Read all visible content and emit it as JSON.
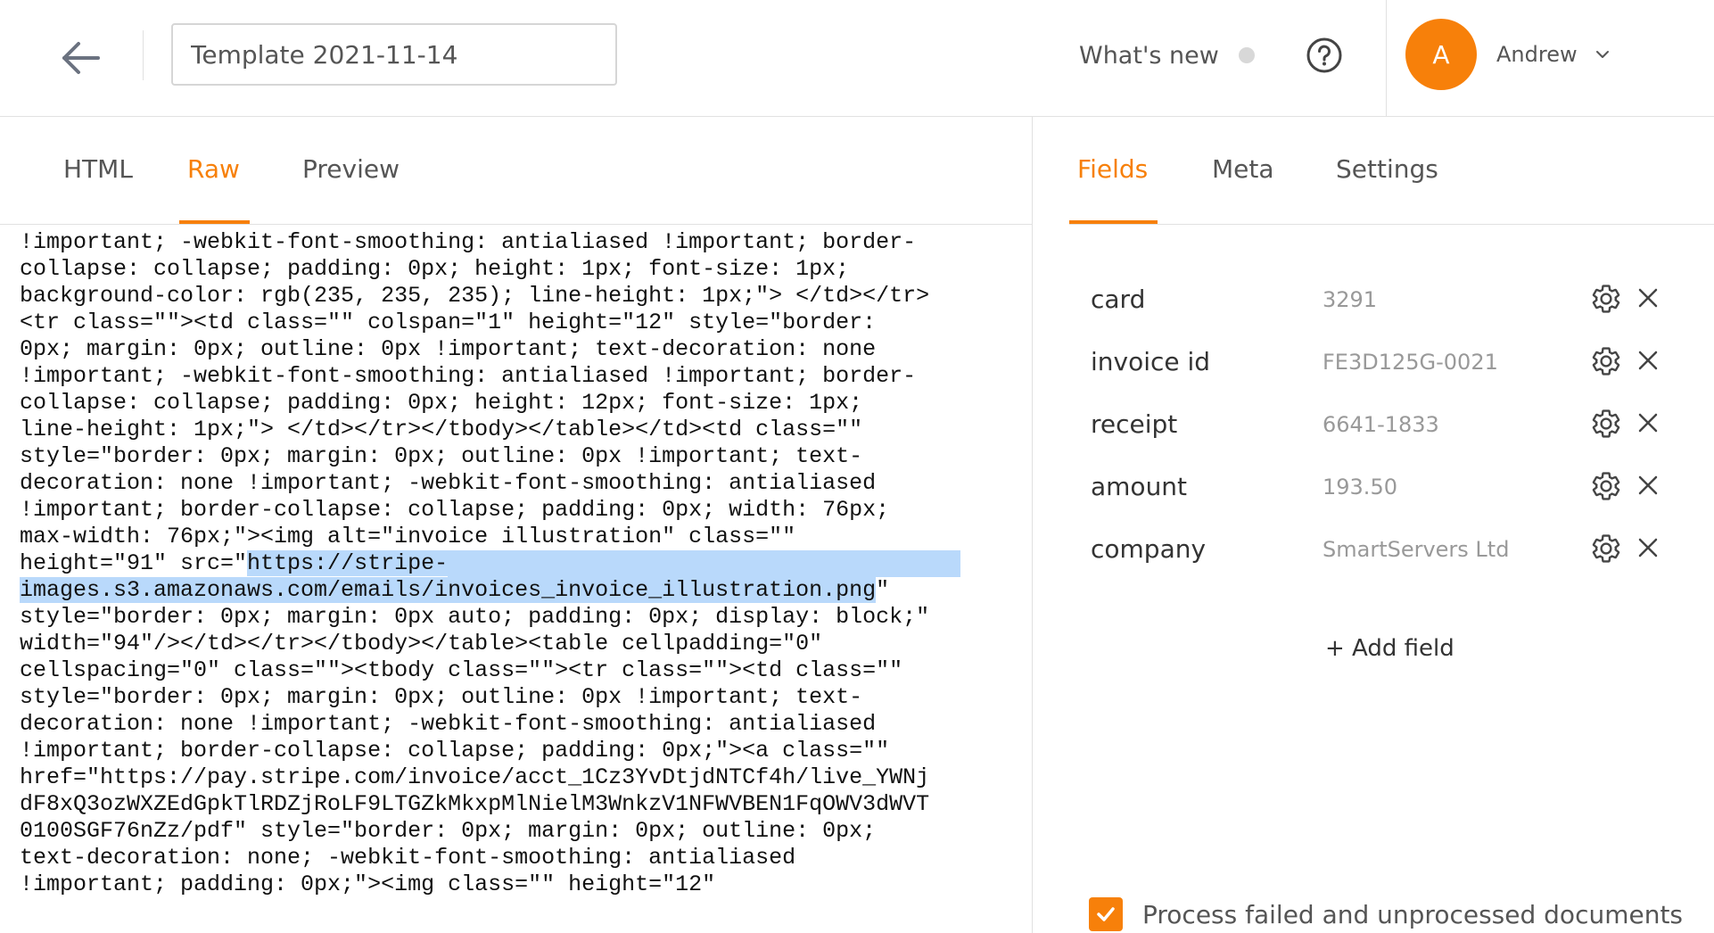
{
  "header": {
    "title_value": "Template 2021-11-14",
    "whats_new": "What's new",
    "user": {
      "initial": "A",
      "name": "Andrew"
    }
  },
  "editor": {
    "tabs": [
      {
        "label": "HTML",
        "active": false
      },
      {
        "label": "Raw",
        "active": true
      },
      {
        "label": "Preview",
        "active": false
      }
    ],
    "code_lines": [
      "!important; -webkit-font-smoothing: antialiased !important; border-",
      "collapse: collapse; padding: 0px; height: 1px; font-size: 1px;",
      "background-color: rgb(235, 235, 235); line-height: 1px;\"> </td></tr>",
      "<tr class=\"\"><td class=\"\" colspan=\"1\" height=\"12\" style=\"border:",
      "0px; margin: 0px; outline: 0px !important; text-decoration: none",
      "!important; -webkit-font-smoothing: antialiased !important; border-",
      "collapse: collapse; padding: 0px; height: 12px; font-size: 1px;",
      "line-height: 1px;\"> </td></tr></tbody></table></td><td class=\"\"",
      "style=\"border: 0px; margin: 0px; outline: 0px !important; text-",
      "decoration: none !important; -webkit-font-smoothing: antialiased",
      "!important; border-collapse: collapse; padding: 0px; width: 76px;",
      "max-width: 76px;\"><img alt=\"invoice illustration\" class=\"\"",
      "height=\"91\" src=\"",
      "https://stripe-",
      "images.s3.amazonaws.com/emails/invoices_invoice_illustration.png",
      "\"",
      "style=\"border: 0px; margin: 0px auto; padding: 0px; display: block;\"",
      "width=\"94\"/></td></tr></tbody></table><table cellpadding=\"0\"",
      "cellspacing=\"0\" class=\"\"><tbody class=\"\"><tr class=\"\"><td class=\"\"",
      "style=\"border: 0px; margin: 0px; outline: 0px !important; text-",
      "decoration: none !important; -webkit-font-smoothing: antialiased",
      "!important; border-collapse: collapse; padding: 0px;\"><a class=\"\"",
      "href=\"https://pay.stripe.com/invoice/acct_1Cz3YvDtjdNTCf4h/live_YWNj",
      "dF8xQ3ozWXZEdGpkTlRDZjRoLF9LTGZkMkxpMlNielM3WnkzV1NFWVBEN1FqOWV3dWVT",
      "0100SGF76nZz/pdf\" style=\"border: 0px; margin: 0px; outline: 0px;",
      "text-decoration: none; -webkit-font-smoothing: antialiased",
      "!important; padding: 0px;\"><img class=\"\" height=\"12\""
    ]
  },
  "panel": {
    "tabs": [
      {
        "label": "Fields",
        "active": true
      },
      {
        "label": "Meta",
        "active": false
      },
      {
        "label": "Settings",
        "active": false
      }
    ],
    "fields": [
      {
        "name": "card",
        "value": "3291"
      },
      {
        "name": "invoice id",
        "value": "FE3D125G-0021"
      },
      {
        "name": "receipt",
        "value": "6641-1833"
      },
      {
        "name": "amount",
        "value": "193.50"
      },
      {
        "name": "company",
        "value": "SmartServers Ltd"
      }
    ],
    "add_field": "+ Add field",
    "process_checkbox": {
      "label": "Process failed and unprocessed documents",
      "checked": true
    }
  },
  "colors": {
    "accent": "#f7800a",
    "selection": "#b9d9fb",
    "muted_text": "#999999"
  },
  "icons": [
    "back-arrow-icon",
    "help-icon",
    "chevron-down-icon",
    "gear-icon",
    "close-icon",
    "checkmark-icon"
  ]
}
